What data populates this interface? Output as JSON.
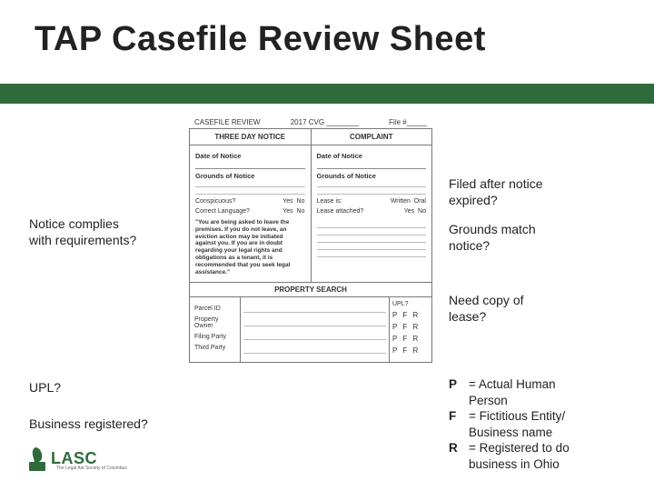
{
  "slide": {
    "title": "TAP Casefile Review Sheet"
  },
  "annotations": {
    "left": {
      "notice_complies_l1": "Notice complies",
      "notice_complies_l2": "with requirements?",
      "upl": "UPL?",
      "business_registered": "Business registered?"
    },
    "right": {
      "filed_after_l1": "Filed after notice",
      "filed_after_l2": "expired?",
      "grounds_match_l1": "Grounds match",
      "grounds_match_l2": "notice?",
      "need_copy_l1": "Need copy of",
      "need_copy_l2": "lease?"
    }
  },
  "legend": {
    "p_key": "P",
    "p_eq": " = Actual Human",
    "p_line2": "Person",
    "f_key": "F",
    "f_eq": " = Fictitious Entity/",
    "f_line2": "Business name",
    "r_key": "R",
    "r_eq": " = Registered to do",
    "r_line2": "business in Ohio"
  },
  "form": {
    "header": {
      "casefile_review": "CASEFILE REVIEW",
      "cvg": "2017 CVG ________",
      "file_no": "File #_____"
    },
    "sections": {
      "three_day_notice": "THREE DAY NOTICE",
      "complaint": "COMPLAINT",
      "property_search": "PROPERTY SEARCH"
    },
    "left_col": {
      "date_of_notice": "Date of Notice",
      "grounds_of_notice": "Grounds of Notice",
      "conspicuous": "Conspicuous?",
      "correct_language": "Correct Language?",
      "yes": "Yes",
      "no": "No",
      "paragraph": "\"You are being asked to leave the premises. If you do not leave, an eviction action may be initiated against you. If you are in doubt regarding your legal rights and obligations as a tenant, it is recommended that you seek legal assistance.\""
    },
    "right_col": {
      "date_of_notice": "Date of Notice",
      "grounds_of_notice": "Grounds of Notice",
      "lease_is": "Lease is:",
      "written": "Written",
      "oral": "Oral",
      "lease_attached": "Lease attached?",
      "yes": "Yes",
      "no": "No"
    },
    "property_search": {
      "parcel_id": "Parcel ID",
      "property_owner": "Property Owner",
      "filing_party": "Filing Party",
      "third_party": "Third Party",
      "upl": "UPL?",
      "pfr": "P  F  R"
    }
  },
  "logo": {
    "name": "LASC",
    "sub": "The Legal Aid Society of Columbus"
  }
}
